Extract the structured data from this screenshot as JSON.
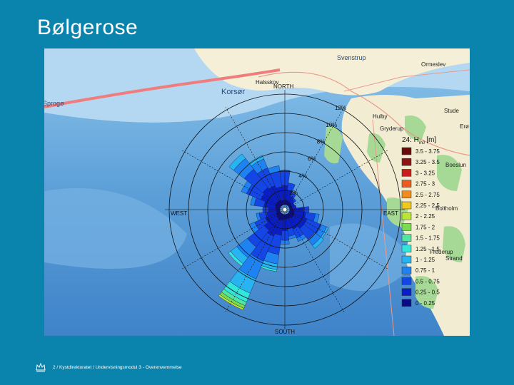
{
  "slide": {
    "title": "Bølgerose",
    "footer": "2 / Kystdirektoratet / Undervisningsmodul 3 - Overenvemmelse"
  },
  "map": {
    "places": [
      "Svenstrup",
      "Halsskov",
      "Korsør",
      "Ormeslev",
      "Hulby",
      "Stude",
      "Gryderup",
      "Erø",
      "Boeslun",
      "Boltholm",
      "Frederup",
      "Strand",
      "Sprogø"
    ]
  },
  "chart_data": {
    "type": "windrose",
    "title": "",
    "legend_title": "24: H",
    "legend_title_sub": "m0",
    "legend_title_unit": "[m]",
    "directions": {
      "north": "NORTH",
      "south": "SOUTH",
      "east": "EAST",
      "west": "WEST"
    },
    "rings": [
      {
        "value": 2,
        "label": "2%"
      },
      {
        "value": 4,
        "label": "4%"
      },
      {
        "value": 6,
        "label": "6%"
      },
      {
        "value": 8,
        "label": "8%"
      },
      {
        "value": 10,
        "label": "10%"
      },
      {
        "value": 12,
        "label": "12%"
      }
    ],
    "bins": [
      {
        "label": "3.5 - 3.75",
        "color": "#6b0a0a"
      },
      {
        "label": "3.25 - 3.5",
        "color": "#8e1414"
      },
      {
        "label": "3 - 3.25",
        "color": "#c81e1e"
      },
      {
        "label": "2.75 - 3",
        "color": "#ef5b1e"
      },
      {
        "label": "2.5 - 2.75",
        "color": "#f08c1e"
      },
      {
        "label": "2.25 - 2.5",
        "color": "#f0c81e"
      },
      {
        "label": "2 - 2.25",
        "color": "#b8e632"
      },
      {
        "label": "1.75 - 2",
        "color": "#78dc50"
      },
      {
        "label": "1.5 - 1.75",
        "color": "#50e6a0"
      },
      {
        "label": "1.25 - 1.5",
        "color": "#32e6dc"
      },
      {
        "label": "1 - 1.25",
        "color": "#28b4f0"
      },
      {
        "label": "0.75 - 1",
        "color": "#1e82f0"
      },
      {
        "label": "0.5 - 0.75",
        "color": "#1446e6"
      },
      {
        "label": "0.25 - 0.5",
        "color": "#0a1ec8"
      },
      {
        "label": "0 - 0.25",
        "color": "#0a0a82"
      }
    ],
    "sectors": [
      {
        "dir": 0,
        "segments": [
          0.5,
          1.5,
          1.6
        ]
      },
      {
        "dir": 15,
        "segments": [
          0.5,
          1.0,
          0.8
        ]
      },
      {
        "dir": 30,
        "segments": [
          0.4,
          0.6,
          0.4
        ]
      },
      {
        "dir": 45,
        "segments": [
          0.4,
          0.4,
          0.2
        ]
      },
      {
        "dir": 60,
        "segments": [
          0.3,
          0.3
        ]
      },
      {
        "dir": 75,
        "segments": [
          0.3,
          0.4
        ]
      },
      {
        "dir": 90,
        "segments": [
          0.4,
          1.0,
          0.6
        ]
      },
      {
        "dir": 105,
        "segments": [
          0.5,
          1.2,
          1.0,
          0.4
        ]
      },
      {
        "dir": 120,
        "segments": [
          0.6,
          1.4,
          1.6,
          0.6,
          0.2
        ]
      },
      {
        "dir": 135,
        "segments": [
          0.6,
          1.4,
          1.4,
          0.8,
          0.4
        ]
      },
      {
        "dir": 150,
        "segments": [
          0.5,
          1.2,
          1.0,
          0.4
        ]
      },
      {
        "dir": 165,
        "segments": [
          0.5,
          1.0,
          0.8,
          0.3
        ]
      },
      {
        "dir": 180,
        "segments": [
          0.5,
          1.2,
          1.0,
          0.4
        ]
      },
      {
        "dir": 195,
        "segments": [
          0.6,
          1.6,
          2.0,
          1.0,
          0.6,
          0.2
        ]
      },
      {
        "dir": 210,
        "segments": [
          0.7,
          1.8,
          2.8,
          2.0,
          1.6,
          1.0,
          0.4,
          0.3,
          0.2
        ]
      },
      {
        "dir": 225,
        "segments": [
          0.6,
          1.6,
          2.2,
          1.4,
          0.8,
          0.3
        ]
      },
      {
        "dir": 240,
        "segments": [
          0.5,
          1.2,
          1.2,
          0.6
        ]
      },
      {
        "dir": 255,
        "segments": [
          0.4,
          1.0,
          0.8,
          0.3
        ]
      },
      {
        "dir": 270,
        "segments": [
          0.4,
          0.8,
          0.6
        ]
      },
      {
        "dir": 285,
        "segments": [
          0.5,
          1.2,
          1.0,
          0.4
        ]
      },
      {
        "dir": 300,
        "segments": [
          0.6,
          1.6,
          1.6,
          0.6
        ]
      },
      {
        "dir": 315,
        "segments": [
          0.6,
          1.8,
          2.4,
          1.4,
          0.6
        ]
      },
      {
        "dir": 330,
        "segments": [
          0.6,
          1.6,
          2.0,
          1.0,
          0.4
        ]
      },
      {
        "dir": 345,
        "segments": [
          0.5,
          1.4,
          1.6,
          0.6
        ]
      }
    ]
  }
}
